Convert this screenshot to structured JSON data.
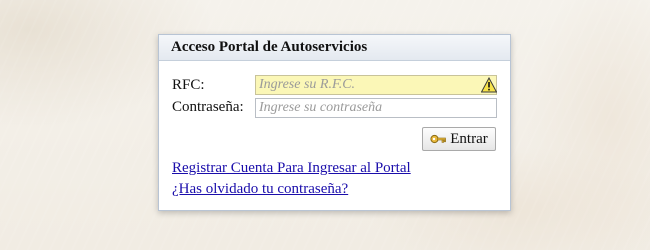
{
  "panel": {
    "title": "Acceso Portal de Autoservicios"
  },
  "form": {
    "rfc_label": "RFC:",
    "rfc_placeholder": "Ingrese su R.F.C.",
    "password_label": "Contraseña:",
    "password_placeholder": "Ingrese su contraseña",
    "rfc_warning_icon": "warning-icon",
    "submit_icon": "key-icon",
    "submit_label": "Entrar"
  },
  "links": {
    "register": "Registrar Cuenta Para Ingresar al Portal",
    "forgot": "¿Has olvidado tu contraseña?"
  },
  "colors": {
    "rfc_field_bg": "#fbf7b7",
    "link": "#1a0dab",
    "panel_border": "#b8c4d4"
  }
}
